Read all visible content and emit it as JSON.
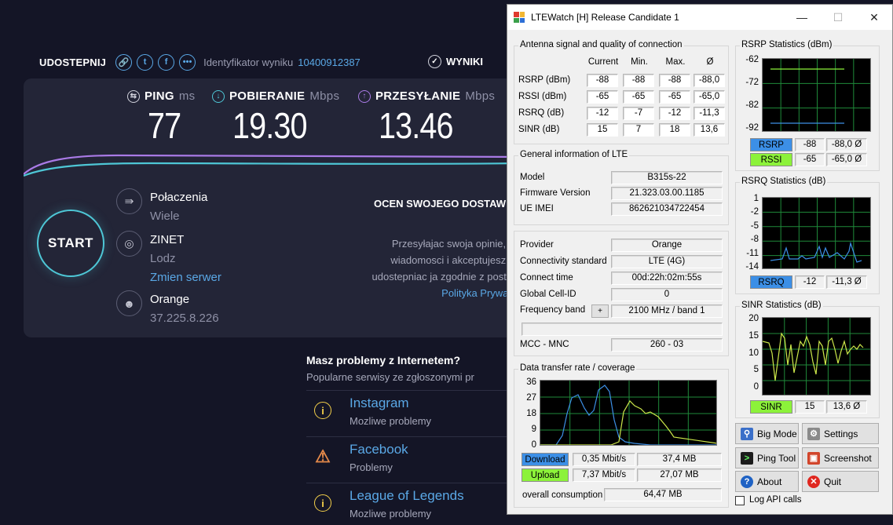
{
  "speedtest": {
    "share_label": "UDOSTEPNIJ",
    "result_id_label": "Identyfikator wyniku",
    "result_id": "10400912387",
    "results_label": "WYNIKI",
    "ping": {
      "label": "PING",
      "unit": "ms",
      "value": "77"
    },
    "download": {
      "label": "POBIERANIE",
      "unit": "Mbps",
      "value": "19.30"
    },
    "upload": {
      "label": "PRZESYŁANIE",
      "unit": "Mbps",
      "value": "13.46"
    },
    "start_label": "START",
    "connections": {
      "title": "Połaczenia",
      "value": "Wiele"
    },
    "server": {
      "title": "ZINET",
      "city": "Lodz",
      "change_label": "Zmien serwer"
    },
    "isp": {
      "name": "Orange",
      "ip": "37.225.8.226"
    },
    "rate": {
      "title": "OCEN SWOJEGO DOSTAW",
      "line1": "Przesyłajac swoja opinie, przyjm",
      "line2": "wiadomosci i akceptujesz, ze Oo",
      "line3": "udostepniac ja zgodnie z postanowie",
      "policy_link": "Polityka Prywatnosci",
      "policy_suffix": "."
    },
    "problems": {
      "title": "Masz problemy z Internetem?",
      "subtitle": "Popularne serwisy ze zgłoszonymi pr",
      "items": [
        {
          "name": "Instagram",
          "status": "Mozliwe problemy",
          "icon": "info-icon"
        },
        {
          "name": "Facebook",
          "status": "Problemy",
          "icon": "warning-icon"
        },
        {
          "name": "League of Legends",
          "status": "Mozliwe problemy",
          "icon": "info-icon"
        }
      ]
    }
  },
  "ltewatch": {
    "title": "LTEWatch [H]   Release Candidate 1",
    "signal": {
      "group_title": "Antenna signal and quality of connection",
      "headers": [
        "Current",
        "Min.",
        "Max.",
        "Ø"
      ],
      "rows": [
        {
          "label": "RSRP (dBm)",
          "values": [
            "-88",
            "-88",
            "-88",
            "-88,0"
          ]
        },
        {
          "label": "RSSI (dBm)",
          "values": [
            "-65",
            "-65",
            "-65",
            "-65,0"
          ]
        },
        {
          "label": "RSRQ (dB)",
          "values": [
            "-12",
            "-7",
            "-12",
            "-11,3"
          ]
        },
        {
          "label": "SINR (dB)",
          "values": [
            "15",
            "7",
            "18",
            "13,6"
          ]
        }
      ]
    },
    "general": {
      "group_title": "General information of LTE",
      "model_label": "Model",
      "model": "B315s-22",
      "firmware_label": "Firmware Version",
      "firmware": "21.323.03.00.1185",
      "imei_label": "UE IMEI",
      "imei": "862621034722454"
    },
    "network": {
      "provider_label": "Provider",
      "provider": "Orange",
      "standard_label": "Connectivity standard",
      "standard": "LTE (4G)",
      "connect_time_label": "Connect time",
      "connect_time": "00d:22h:02m:55s",
      "cell_label": "Global Cell-ID",
      "cell": "0",
      "band_label": "Frequency band",
      "band_button": "+",
      "band": "2100 MHz / band 1",
      "band_extra": "",
      "mcc_label": "MCC - MNC",
      "mcc": "260 - 03"
    },
    "transfer": {
      "group_title": "Data transfer rate / coverage",
      "yticks": [
        "36",
        "27",
        "18",
        "9",
        "0"
      ],
      "download_label": "Download",
      "download_rate": "0,35 Mbit/s",
      "download_total": "37,4 MB",
      "upload_label": "Upload",
      "upload_rate": "7,37 Mbit/s",
      "upload_total": "27,07 MB",
      "overall_label": "overall consumption",
      "overall": "64,47 MB"
    },
    "rsrp_stats": {
      "group_title": "RSRP Statistics (dBm)",
      "yticks": [
        "-62",
        "-72",
        "-82",
        "-92"
      ],
      "rows": [
        {
          "label": "RSRP",
          "current": "-88",
          "avg": "-88,0 Ø",
          "color": "#3c8fe6"
        },
        {
          "label": "RSSI",
          "current": "-65",
          "avg": "-65,0 Ø",
          "color": "#8cf23a"
        }
      ]
    },
    "rsrq_stats": {
      "group_title": "RSRQ Statistics (dB)",
      "yticks": [
        "1",
        "-2",
        "-5",
        "-8",
        "-11",
        "-14"
      ],
      "label": "RSRQ",
      "current": "-12",
      "avg": "-11,3 Ø",
      "color": "#3c8fe6"
    },
    "sinr_stats": {
      "group_title": "SINR Statistics (dB)",
      "yticks": [
        "20",
        "15",
        "10",
        "5",
        "0"
      ],
      "label": "SINR",
      "current": "15",
      "avg": "13,6 Ø",
      "color": "#8cf23a"
    },
    "buttons": {
      "big_mode": "Big Mode",
      "settings": "Settings",
      "ping_tool": "Ping Tool",
      "screenshot": "Screenshot",
      "about": "About",
      "quit": "Quit"
    },
    "log_api_label": "Log API calls"
  }
}
